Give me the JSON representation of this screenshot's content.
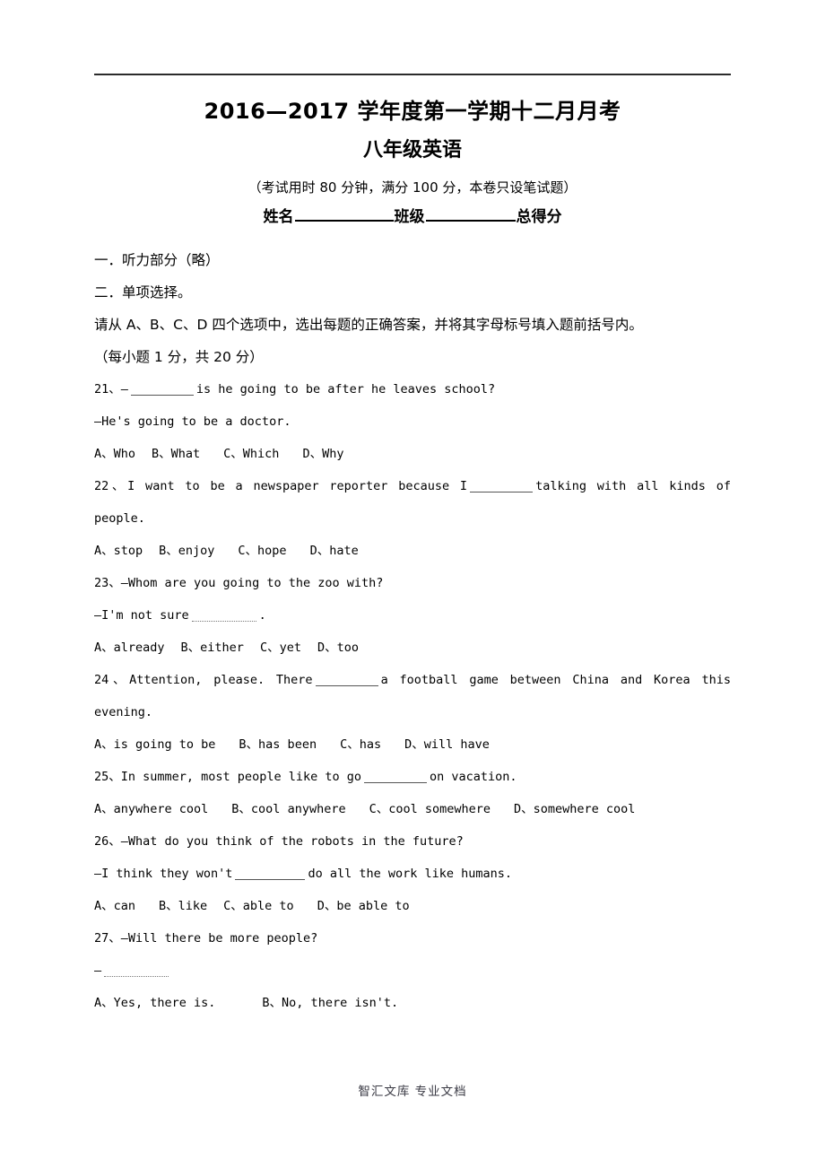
{
  "document": {
    "title": "2016—2017 学年度第一学期十二月月考",
    "subtitle": "八年级英语",
    "exam_info": "（考试用时 80 分钟，满分 100 分，本卷只设笔试题）",
    "id_fields": {
      "name_label": "姓名",
      "class_label": "班级",
      "total_score_label": "总得分"
    }
  },
  "sections": {
    "section_one": "一．听力部分（略）",
    "section_two": "二．单项选择。",
    "instruction": "请从 A、B、C、D 四个选项中，选出每题的正确答案，并将其字母标号填入题前括号内。",
    "points": "（每小题 1 分，共 20 分）"
  },
  "questions": [
    {
      "number": "21、",
      "stem_prefix": "—",
      "stem_suffix": "is he going to be after he leaves school?",
      "reply": "—He's going to be a doctor.",
      "options": [
        "A、Who",
        "B、What",
        "C、Which",
        "D、Why"
      ]
    },
    {
      "number": "22、",
      "stem_prefix": "I want to be a newspaper reporter because I",
      "stem_suffix": "talking with all kinds of",
      "stem_wrap": "people.",
      "options": [
        "A、stop",
        "B、enjoy",
        "C、hope",
        "D、hate"
      ]
    },
    {
      "number": "23、",
      "stem_prefix": "—Whom are you going to the zoo with?",
      "reply_prefix": "—I'm not sure",
      "reply_suffix": ".",
      "options": [
        "A、already",
        "B、either",
        "C、yet",
        "D、too"
      ]
    },
    {
      "number": "24、",
      "stem_prefix": "Attention, please. There",
      "stem_suffix": "a football game between China and Korea this",
      "stem_wrap": "evening.",
      "options": [
        "A、is going to be",
        "B、has been",
        "C、has",
        "D、will have"
      ]
    },
    {
      "number": "25、",
      "stem_prefix": "In summer, most people like to go",
      "stem_suffix": "on vacation.",
      "options": [
        "A、anywhere cool",
        "B、cool anywhere",
        "C、cool somewhere",
        "D、somewhere cool"
      ]
    },
    {
      "number": "26、",
      "stem_prefix": "—What do you think of the robots in the future?",
      "reply_prefix": "—I think they won't",
      "reply_suffix": "do all the work like humans.",
      "options": [
        "A、can",
        "B、like",
        "C、able to",
        "D、be able to"
      ]
    },
    {
      "number": "27、",
      "stem_prefix": "—Will there be more people?",
      "reply_prefix": "—",
      "options": [
        "A、Yes, there is.",
        "B、No, there isn't."
      ]
    }
  ],
  "footer": {
    "text": "智汇文库 专业文档"
  }
}
